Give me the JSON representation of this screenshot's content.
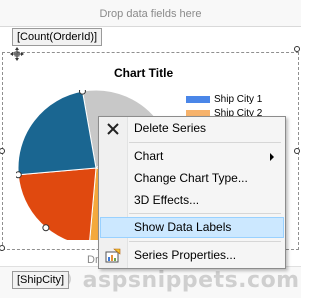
{
  "data_drop_zone": {
    "hint": "Drop data fields here"
  },
  "data_field": {
    "label": "[Count(OrderId)]"
  },
  "category_field": {
    "label": "[ShipCity]"
  },
  "series_drop_zone": {
    "hint": "Dr"
  },
  "chart": {
    "title": "Chart Title",
    "legend": [
      {
        "label": "Ship City 1",
        "color": "#4a86e8"
      },
      {
        "label": "Ship City 2",
        "color": "#f6b26b"
      }
    ],
    "slice_colors": [
      "#c8c8c8",
      "#1f3f6e",
      "#f4a93c",
      "#e0490f",
      "#1a6691"
    ]
  },
  "context_menu": {
    "items": [
      {
        "label": "Delete Series",
        "icon": "close-icon"
      },
      {
        "label": "Chart",
        "has_submenu": true
      },
      {
        "label": "Change Chart Type..."
      },
      {
        "label": "3D Effects..."
      },
      {
        "label": "Show Data Labels",
        "highlighted": true
      },
      {
        "label": "Series Properties...",
        "icon": "series-properties-icon"
      }
    ]
  },
  "watermark": {
    "text": "© aspsnippets.com"
  }
}
